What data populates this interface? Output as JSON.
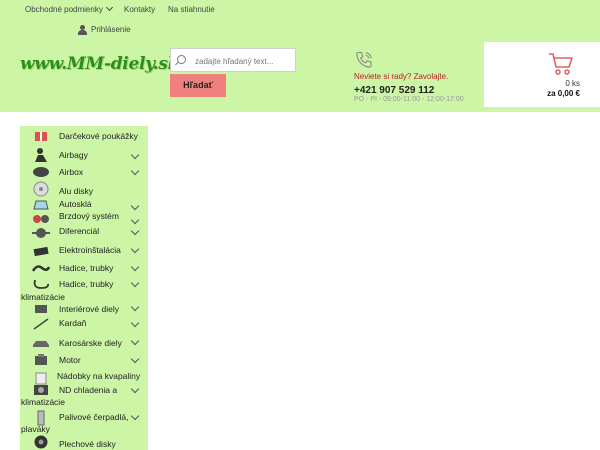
{
  "topnav": {
    "terms": "Obchodné podmienky",
    "contacts": "Kontakty",
    "download": "Na stiahnutie",
    "login": "Prihlásenie"
  },
  "logo": {
    "text": "www.MM-diely.sk"
  },
  "search": {
    "placeholder": "zadajte hľadaný text...",
    "button": "Hľadať"
  },
  "contact": {
    "question": "Neviete si rady? Zavolajte.",
    "phone": "+421 907 529 112",
    "hours": "PO - PI - 09:00-11:00 - 12:00-17:00"
  },
  "cart": {
    "count": "0 ks",
    "total": "za 0,00 €"
  },
  "categories": [
    {
      "label": "Darčekové poukážky",
      "line2": ""
    },
    {
      "label": "Airbagy",
      "line2": ""
    },
    {
      "label": "Airbox",
      "line2": ""
    },
    {
      "label": "Alu disky",
      "line2": ""
    },
    {
      "label": "Autosklá",
      "line2": ""
    },
    {
      "label": "Brzdový systém",
      "line2": ""
    },
    {
      "label": "Diferenciál",
      "line2": ""
    },
    {
      "label": "Elektroinštalácia",
      "line2": ""
    },
    {
      "label": "Hadice, trubky",
      "line2": ""
    },
    {
      "label": "Hadice, trubky",
      "line2": "klimatizácie"
    },
    {
      "label": "Interiérové diely",
      "line2": ""
    },
    {
      "label": "Kardaň",
      "line2": ""
    },
    {
      "label": "Karosárske diely",
      "line2": ""
    },
    {
      "label": "Motor",
      "line2": ""
    },
    {
      "label": "Nádobky na kvapaliny",
      "line2": ""
    },
    {
      "label": "ND chladenia a",
      "line2": "klimatizácie"
    },
    {
      "label": "Palivové čerpadlá,",
      "line2": "plaváky"
    },
    {
      "label": "Plechové disky",
      "line2": ""
    }
  ],
  "colors": {
    "header_bg": "#ccf5a6",
    "button": "#f08080",
    "logo": "#2f8d1a",
    "cart_icon": "#e06060"
  }
}
